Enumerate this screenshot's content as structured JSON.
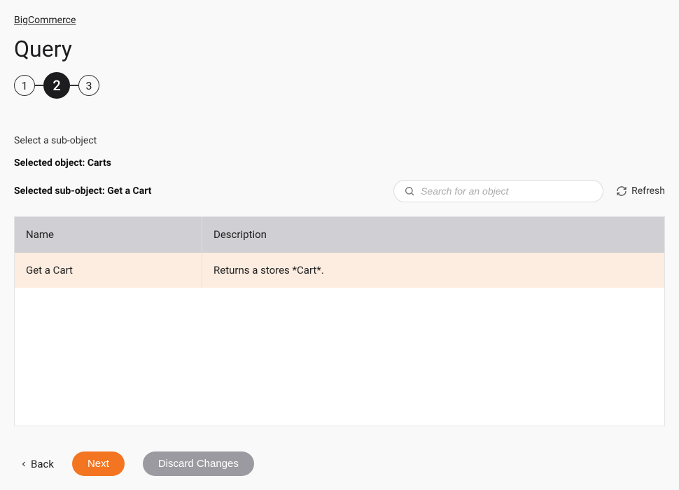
{
  "breadcrumb": "BigCommerce",
  "page_title": "Query",
  "stepper": {
    "steps": [
      "1",
      "2",
      "3"
    ],
    "active_index": 1
  },
  "instruction": "Select a sub-object",
  "selected_object_label": "Selected object: Carts",
  "selected_sub_label": "Selected sub-object: Get a Cart",
  "search": {
    "placeholder": "Search for an object"
  },
  "refresh_label": "Refresh",
  "table": {
    "headers": {
      "name": "Name",
      "description": "Description"
    },
    "rows": [
      {
        "name": "Get a Cart",
        "description": "Returns a stores *Cart*."
      }
    ]
  },
  "footer": {
    "back": "Back",
    "next": "Next",
    "discard": "Discard Changes"
  }
}
